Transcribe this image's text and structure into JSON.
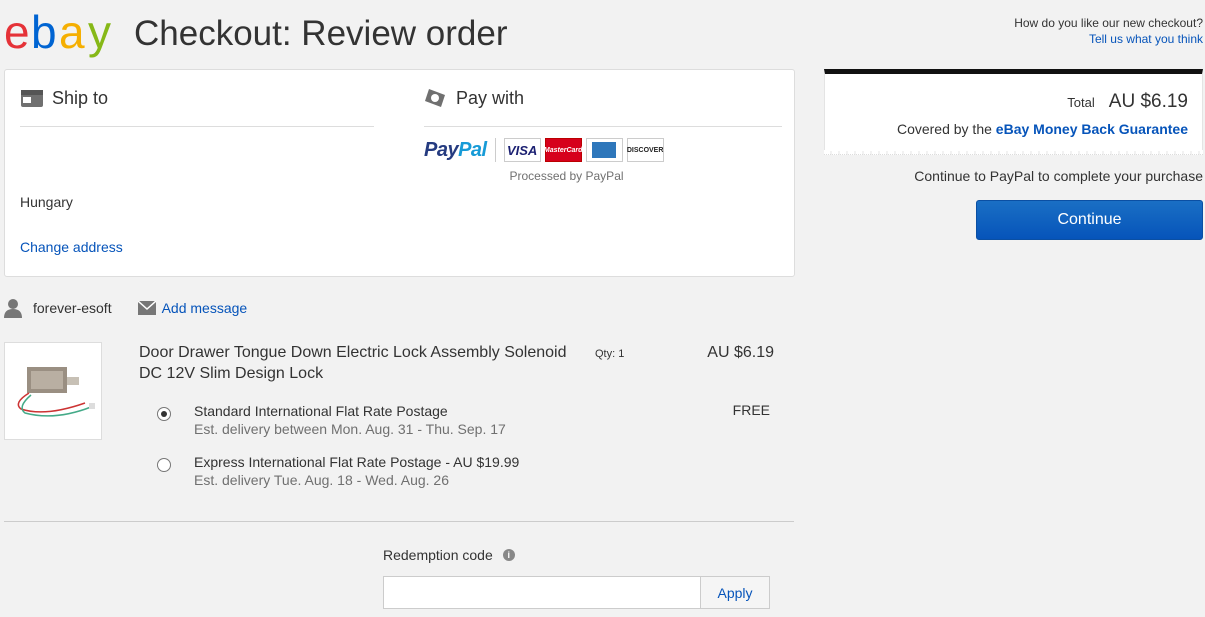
{
  "header": {
    "logo_letters": [
      "e",
      "b",
      "a",
      "y"
    ],
    "title": "Checkout: Review order",
    "feedback_question": "How do you like our new checkout?",
    "feedback_link": "Tell us what you think"
  },
  "ship_to": {
    "heading": "Ship to",
    "country": "Hungary",
    "change_link": "Change address"
  },
  "pay_with": {
    "heading": "Pay with",
    "paypal_part1": "Pay",
    "paypal_part2": "Pal",
    "cards": [
      "VISA",
      "MasterCard",
      "American Express",
      "DISCOVER"
    ],
    "visa_label": "VISA",
    "mc_label": "MasterCard",
    "discover_label": "DISCOVER",
    "processed_by": "Processed by PayPal"
  },
  "seller": {
    "name": "forever-esoft",
    "add_message": "Add message"
  },
  "item": {
    "title": "Door Drawer Tongue Down Electric Lock Assembly Solenoid DC 12V Slim Design Lock",
    "qty": "Qty: 1",
    "price": "AU $6.19"
  },
  "shipping_options": [
    {
      "name": "Standard International Flat Rate Postage",
      "estimate": "Est. delivery between Mon. Aug. 31 - Thu. Sep. 17",
      "price": "FREE",
      "selected": true
    },
    {
      "name": "Express International Flat Rate Postage - AU $19.99",
      "estimate": "Est. delivery Tue. Aug. 18 - Wed. Aug. 26",
      "selected": false
    }
  ],
  "redemption": {
    "label": "Redemption code",
    "info_glyph": "i",
    "input_value": "",
    "apply_label": "Apply"
  },
  "summary": {
    "total_label": "Total",
    "total_value": "AU $6.19",
    "covered_prefix": "Covered by the ",
    "guarantee_link": "eBay Money Back Guarantee",
    "continue_text": "Continue to PayPal to complete your purchase",
    "continue_button": "Continue"
  },
  "colors": {
    "ebay_e": "#e53238",
    "ebay_b": "#0064d2",
    "ebay_a": "#f5af02",
    "ebay_y": "#86b817",
    "link": "#0654ba",
    "continue_button": "#0654ba"
  }
}
